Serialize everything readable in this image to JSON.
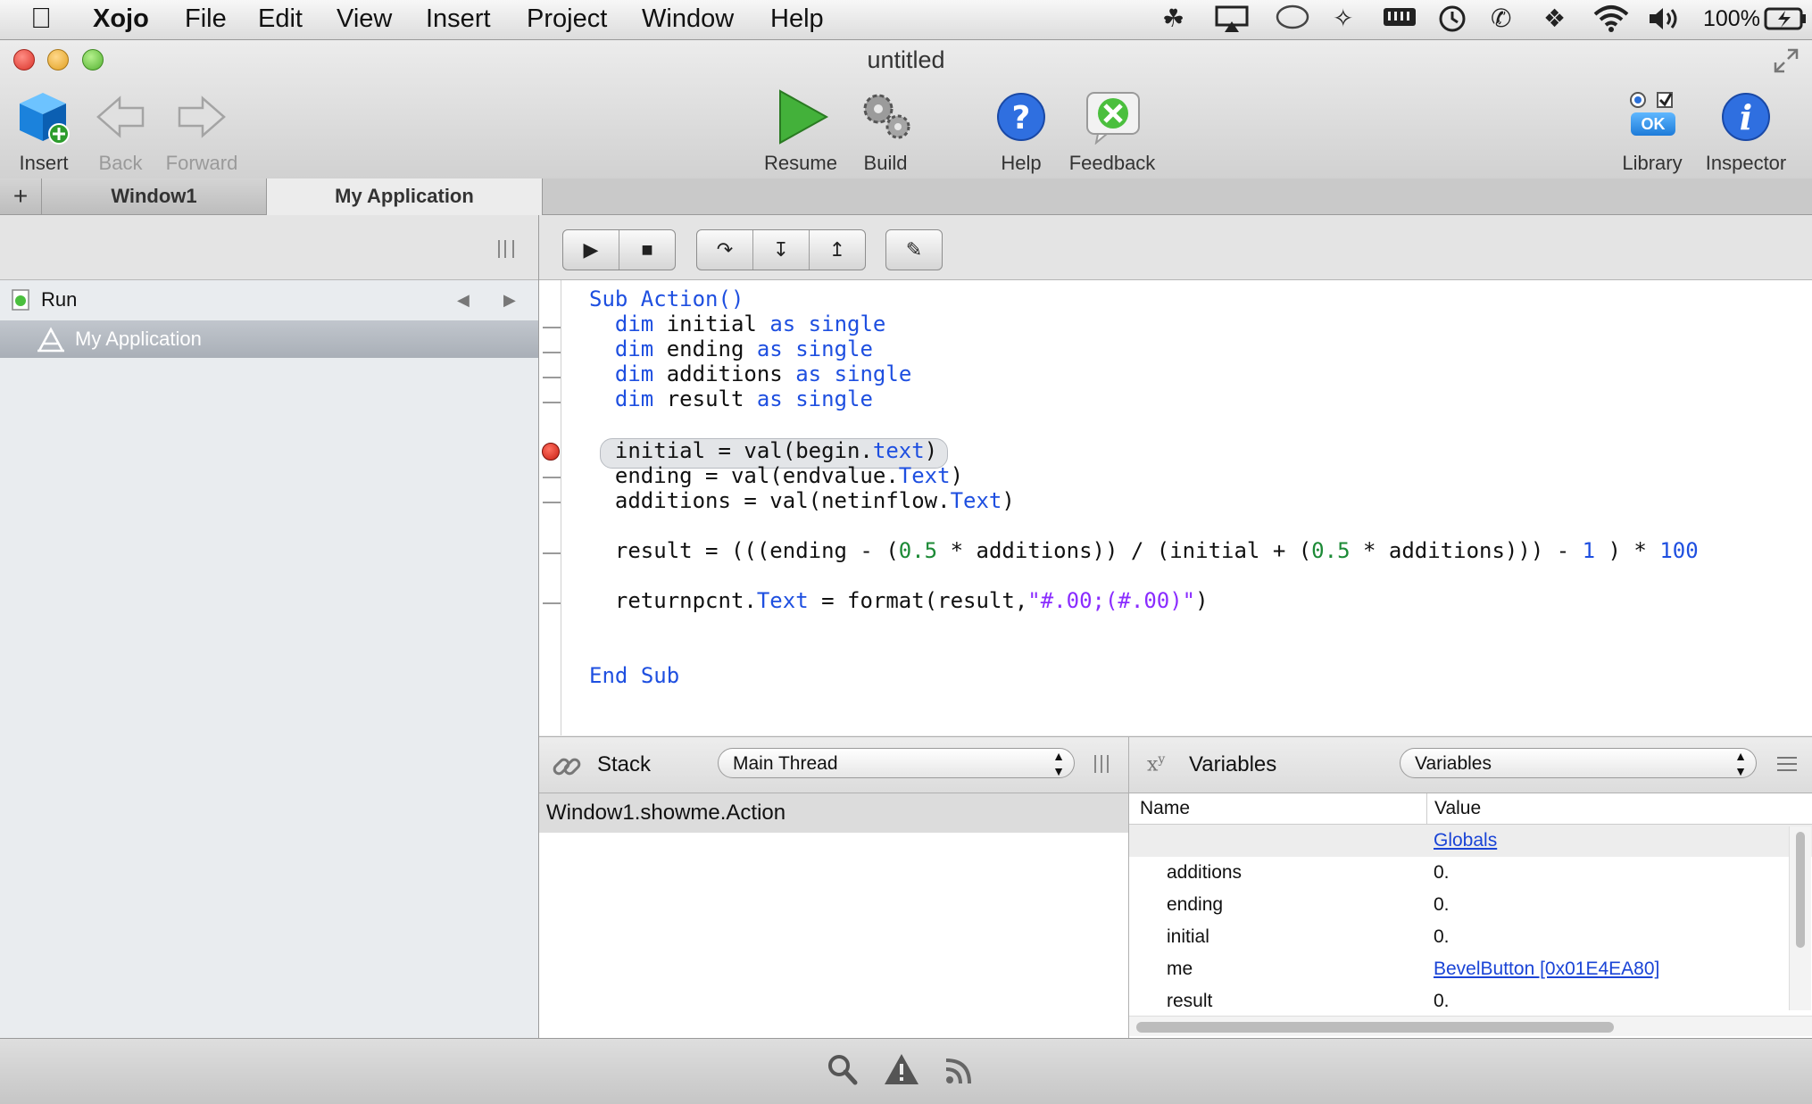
{
  "menubar": {
    "app_name": "Xojo",
    "items": [
      "File",
      "Edit",
      "View",
      "Insert",
      "Project",
      "Window",
      "Help"
    ],
    "battery_text": "100%"
  },
  "window": {
    "title": "untitled"
  },
  "toolbar": {
    "insert": "Insert",
    "back": "Back",
    "forward": "Forward",
    "resume": "Resume",
    "build": "Build",
    "help": "Help",
    "feedback": "Feedback",
    "library": "Library",
    "library_ok": "OK",
    "inspector": "Inspector"
  },
  "tabs": {
    "add": "+",
    "items": [
      "Window1",
      "My Application"
    ]
  },
  "navigator": {
    "run_label": "Run",
    "app_label": "My Application"
  },
  "code": {
    "lines": [
      "Sub Action()",
      "  dim initial as single",
      "  dim ending as single",
      "  dim additions as single",
      "  dim result as single",
      "  initial = val(begin.text)",
      "  ending = val(endvalue.Text)",
      "  additions = val(netinflow.Text)",
      "  result = (((ending - (0.5 * additions)) / (initial + (0.5 * additions))) - 1 ) * 100",
      "  returnpcnt.Text = format(result,\"#.00;(#.00)\")",
      "End Sub"
    ]
  },
  "stack": {
    "title": "Stack",
    "thread": "Main Thread",
    "frames": [
      "Window1.showme.Action"
    ]
  },
  "variables": {
    "title": "Variables",
    "popup": "Variables",
    "col_name": "Name",
    "col_value": "Value",
    "globals": "Globals",
    "rows": [
      {
        "name": "additions",
        "value": "0."
      },
      {
        "name": "ending",
        "value": "0."
      },
      {
        "name": "initial",
        "value": "0."
      },
      {
        "name": "me",
        "value": "BevelButton [0x01E4EA80]"
      },
      {
        "name": "result",
        "value": "0."
      }
    ]
  },
  "colors": {
    "keyword": "#1e4fe0",
    "number": "#1c8a36",
    "string": "#8a2cff",
    "breakpoint": "#d0201a",
    "selection": "#b9bec6"
  }
}
